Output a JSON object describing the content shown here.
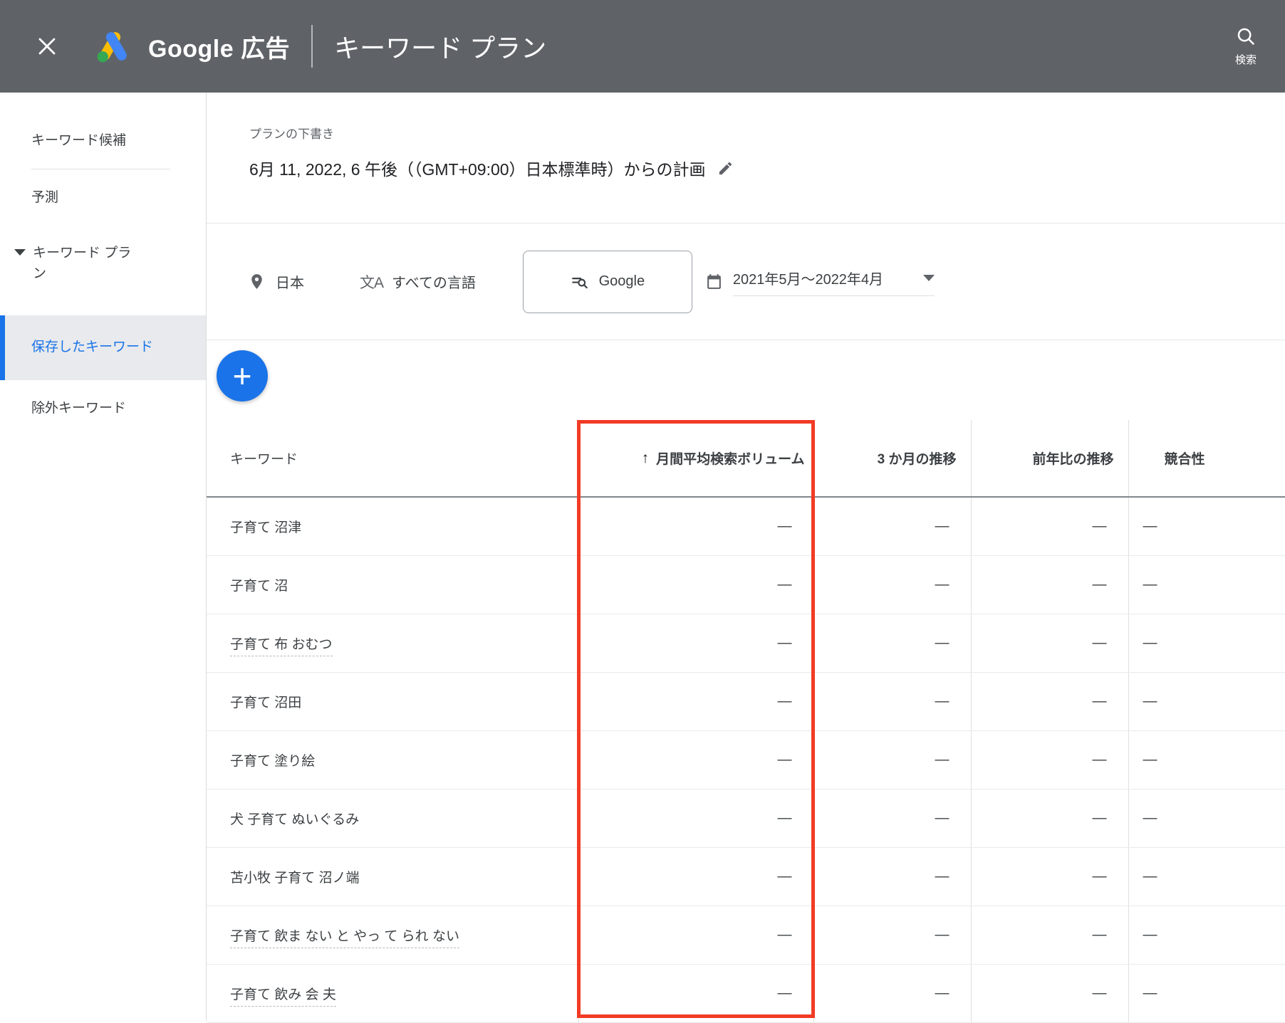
{
  "topbar": {
    "brand": "Google 広告",
    "page_title": "キーワード プラン",
    "search_label": "検索"
  },
  "sidebar": {
    "items": [
      {
        "label": "キーワード候補"
      },
      {
        "label": "予測"
      },
      {
        "label": "キーワード プラン"
      },
      {
        "label": "保存したキーワード"
      },
      {
        "label": "除外キーワード"
      }
    ],
    "selected_item": "保存したキーワード"
  },
  "plan": {
    "draft_label": "プランの下書き",
    "title": "6月 11, 2022, 6 午後（（GMT+09:00）日本標準時）からの計画"
  },
  "filters": {
    "location": "日本",
    "language": "すべての言語",
    "language_icon_glyph": "文A",
    "network": "Google",
    "date_range": "2021年5月〜2022年4月"
  },
  "fab": {
    "label": "+"
  },
  "table": {
    "headers": {
      "keyword": "キーワード",
      "avg_monthly_searches": "月間平均検索ボリューム",
      "three_month_change": "3 か月の推移",
      "yoy_change": "前年比の推移",
      "competition": "競合性"
    },
    "sort": {
      "column": "avg_monthly_searches",
      "direction_icon": "↑"
    },
    "rows": [
      {
        "keyword": "子育て 沼津",
        "volume": "—",
        "three_month": "—",
        "yoy": "—",
        "competition": "—",
        "misspelled": false
      },
      {
        "keyword": "子育て 沼",
        "volume": "—",
        "three_month": "—",
        "yoy": "—",
        "competition": "—",
        "misspelled": false
      },
      {
        "keyword": "子育て 布 おむつ",
        "volume": "—",
        "three_month": "—",
        "yoy": "—",
        "competition": "—",
        "misspelled": true
      },
      {
        "keyword": "子育て 沼田",
        "volume": "—",
        "three_month": "—",
        "yoy": "—",
        "competition": "—",
        "misspelled": false
      },
      {
        "keyword": "子育て 塗り絵",
        "volume": "—",
        "three_month": "—",
        "yoy": "—",
        "competition": "—",
        "misspelled": false
      },
      {
        "keyword": "犬 子育て ぬいぐるみ",
        "volume": "—",
        "three_month": "—",
        "yoy": "—",
        "competition": "—",
        "misspelled": false
      },
      {
        "keyword": "苫小牧 子育て 沼ノ端",
        "volume": "—",
        "three_month": "—",
        "yoy": "—",
        "competition": "—",
        "misspelled": false
      },
      {
        "keyword": "子育て 飲ま ない と やっ て られ ない",
        "volume": "—",
        "three_month": "—",
        "yoy": "—",
        "competition": "—",
        "misspelled": true
      },
      {
        "keyword": "子育て 飲み 会 夫",
        "volume": "—",
        "three_month": "—",
        "yoy": "—",
        "competition": "—",
        "misspelled": true
      }
    ]
  },
  "annotation": {
    "highlight_color": "#f23b25",
    "highlighted_column": "月間平均検索ボリューム"
  }
}
